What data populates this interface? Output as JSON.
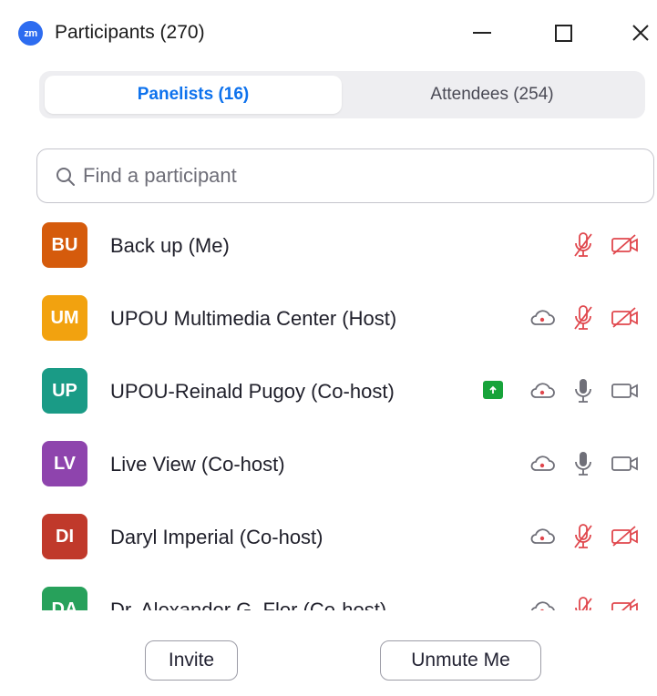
{
  "window": {
    "logo_text": "zm",
    "title": "Participants (270)"
  },
  "tabs": [
    {
      "label": "Panelists (16)",
      "active": true
    },
    {
      "label": "Attendees (254)",
      "active": false
    }
  ],
  "search": {
    "placeholder": "Find a participant",
    "value": ""
  },
  "participants": [
    {
      "initials": "BU",
      "name": "Back up (Me)",
      "avatar_color": "#d55b0c",
      "sharing": false,
      "raise_hand_status": false,
      "mic": "muted",
      "video": "off"
    },
    {
      "initials": "UM",
      "name": "UPOU Multimedia Center (Host)",
      "avatar_color": "#f2a20f",
      "sharing": false,
      "raise_hand_status": true,
      "mic": "muted",
      "video": "off"
    },
    {
      "initials": "UP",
      "name": "UPOU-Reinald Pugoy (Co-host)",
      "avatar_color": "#1a9b86",
      "sharing": true,
      "raise_hand_status": true,
      "mic": "on",
      "video": "on"
    },
    {
      "initials": "LV",
      "name": "Live View (Co-host)",
      "avatar_color": "#8e44ad",
      "sharing": false,
      "raise_hand_status": true,
      "mic": "on",
      "video": "on"
    },
    {
      "initials": "DI",
      "name": "Daryl Imperial (Co-host)",
      "avatar_color": "#c0392b",
      "sharing": false,
      "raise_hand_status": true,
      "mic": "muted",
      "video": "off"
    },
    {
      "initials": "DA",
      "name": "Dr. Alexander G. Flor (Co-host)",
      "avatar_color": "#27a15b",
      "sharing": false,
      "raise_hand_status": true,
      "mic": "muted",
      "video": "off"
    }
  ],
  "footer": {
    "invite_label": "Invite",
    "unmute_label": "Unmute Me"
  },
  "colors": {
    "accent": "#0e72ed",
    "muted_red": "#e0474d",
    "icon_gray": "#6f6f78",
    "share_green": "#17a33a"
  }
}
